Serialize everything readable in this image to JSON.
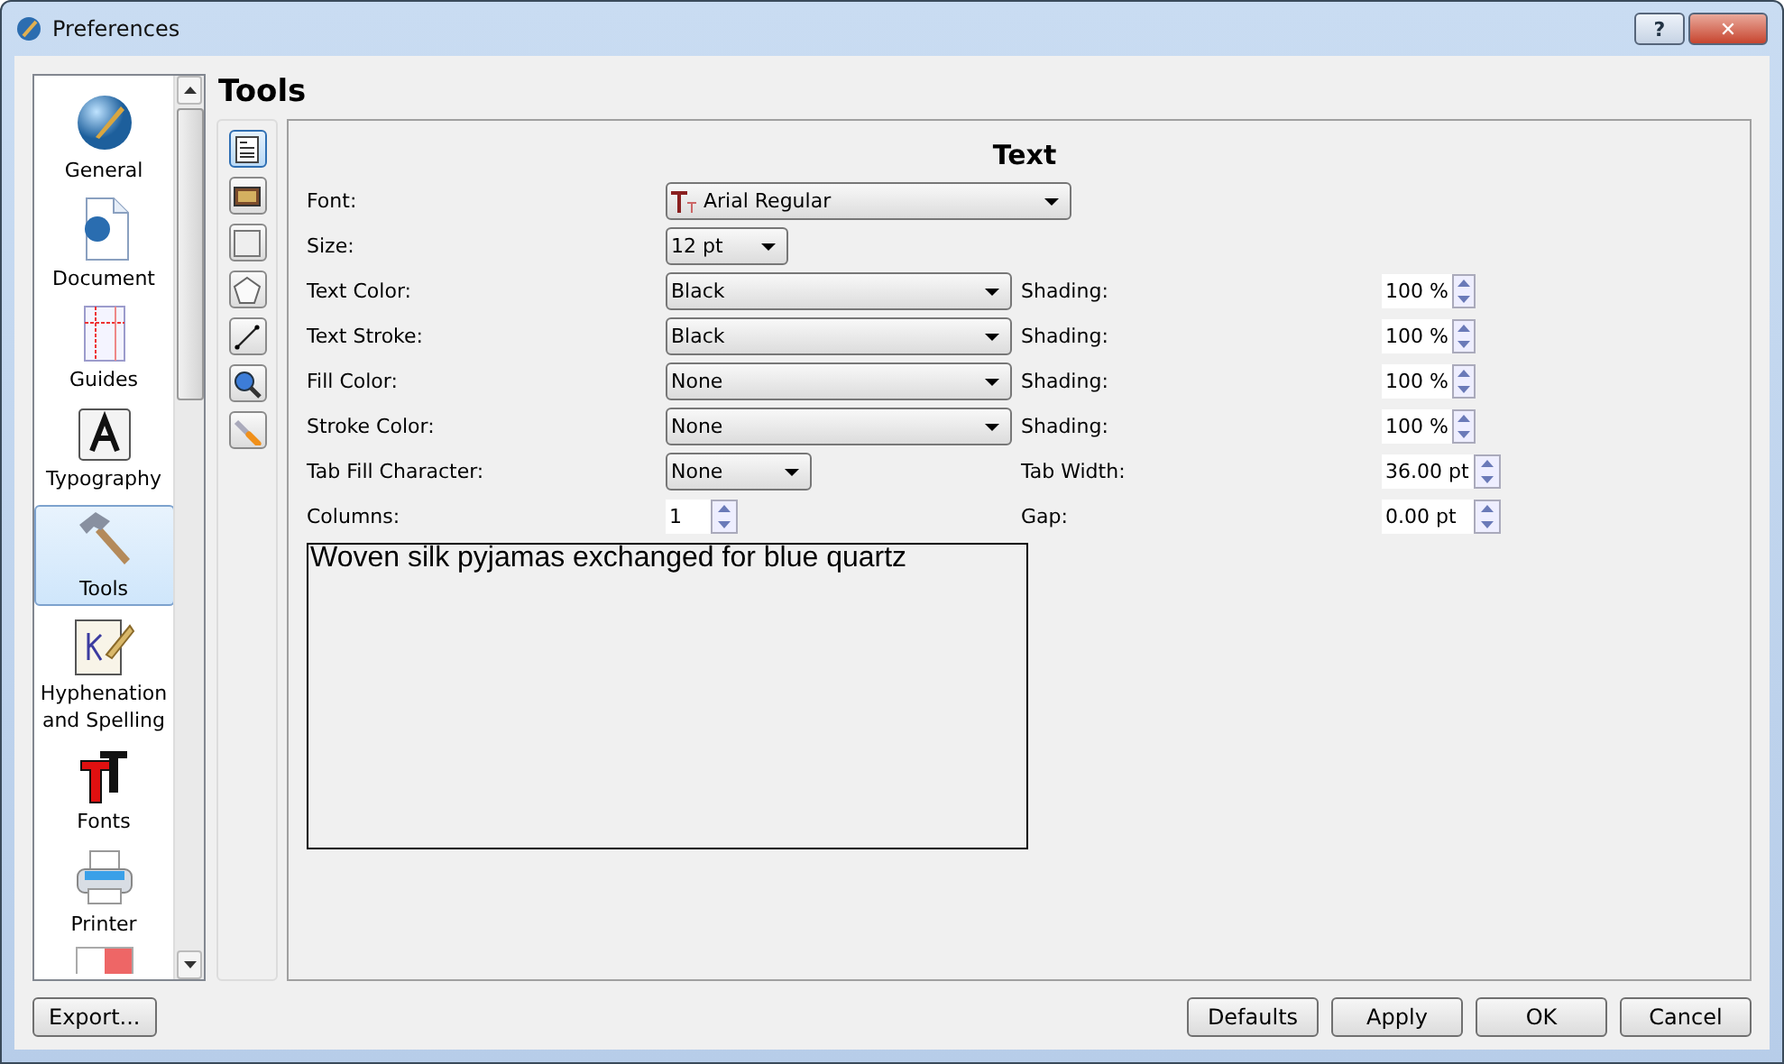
{
  "window": {
    "title": "Preferences",
    "buttons": [
      "?",
      "✕"
    ]
  },
  "sidebar": {
    "items": [
      {
        "label": "General",
        "kind": "globe",
        "selected": false
      },
      {
        "label": "Document",
        "kind": "document",
        "selected": false
      },
      {
        "label": "Guides",
        "kind": "guides",
        "selected": false
      },
      {
        "label": "Typography",
        "kind": "letter",
        "selected": false
      },
      {
        "label": "Tools",
        "kind": "hammer",
        "selected": true
      },
      {
        "label": "Hyphenation and Spelling",
        "kind": "pen",
        "selected": false
      },
      {
        "label": "Fonts",
        "kind": "fonts",
        "selected": false
      },
      {
        "label": "Printer",
        "kind": "printer",
        "selected": false
      }
    ]
  },
  "heading": "Tools",
  "tool_strip": [
    {
      "kind": "text-frame",
      "selected": true
    },
    {
      "kind": "image-frame",
      "selected": false
    },
    {
      "kind": "rectangle",
      "selected": false
    },
    {
      "kind": "pentagon",
      "selected": false
    },
    {
      "kind": "line",
      "selected": false
    },
    {
      "kind": "zoom",
      "selected": false
    },
    {
      "kind": "wrench",
      "selected": false
    }
  ],
  "panel": {
    "title": "Text",
    "rows": [
      {
        "label": "Font:",
        "kind": "font-combo",
        "value": "Arial Regular"
      },
      {
        "label": "Size:",
        "kind": "short-combo",
        "value": "12 pt"
      },
      {
        "label": "Text Color:",
        "kind": "color-combo",
        "value": "Black",
        "extra": {
          "label": "Shading:",
          "value": "100 %"
        }
      },
      {
        "label": "Text Stroke:",
        "kind": "color-combo",
        "value": "Black",
        "extra": {
          "label": "Shading:",
          "value": "100 %"
        }
      },
      {
        "label": "Fill Color:",
        "kind": "color-combo",
        "value": "None",
        "extra": {
          "label": "Shading:",
          "value": "100 %"
        }
      },
      {
        "label": "Stroke Color:",
        "kind": "color-combo",
        "value": "None",
        "extra": {
          "label": "Shading:",
          "value": "100 %"
        }
      },
      {
        "label": "Tab Fill Character:",
        "kind": "fill-combo",
        "value": "None",
        "extra": {
          "label": "Tab Width:",
          "value": "36.00 pt"
        }
      },
      {
        "label": "Columns:",
        "kind": "spin",
        "value": "1",
        "extra": {
          "label": "Gap:",
          "value": "0.00 pt"
        }
      }
    ],
    "preview": "Woven silk pyjamas exchanged for blue quartz"
  },
  "footer": {
    "left": "Export...",
    "right": [
      "Defaults",
      "Apply",
      "OK",
      "Cancel"
    ]
  }
}
